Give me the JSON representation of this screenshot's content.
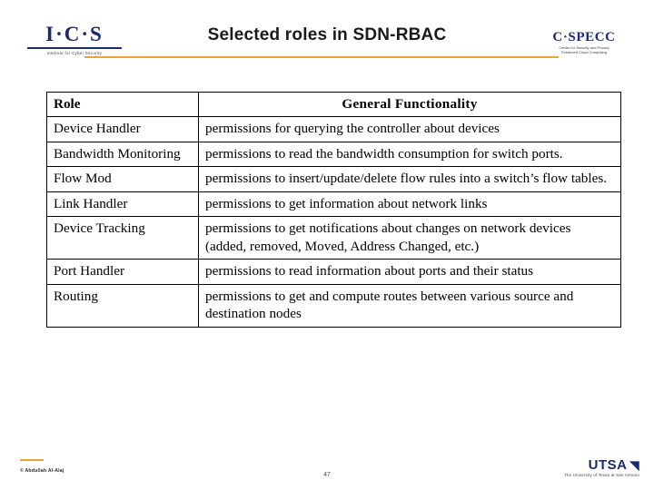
{
  "slide": {
    "title": "Selected roles in SDN-RBAC",
    "accent_color": "#e8a33d",
    "navy_color": "#1b2a6b"
  },
  "logos": {
    "left": {
      "mark": "I·C·S",
      "sub": "Institute for Cyber Security"
    },
    "right": {
      "mark": "C·SPECC",
      "sub1": "Center for Security and Privacy",
      "sub2": "Enhanced Cloud Computing"
    },
    "footer": {
      "mark": "UTSA",
      "glyph": "◥",
      "sub": "The University of Texas at San Antonio"
    }
  },
  "table": {
    "headers": [
      "Role",
      "General  Functionality"
    ],
    "rows": [
      {
        "role": "Device Handler",
        "functionality": "permissions for querying the controller about devices"
      },
      {
        "role": "Bandwidth Monitoring",
        "functionality": "permissions to read the bandwidth consumption for switch ports."
      },
      {
        "role": "Flow Mod",
        "functionality": "permissions to insert/update/delete flow rules into a switch’s flow tables."
      },
      {
        "role": "Link Handler",
        "functionality": "permissions to get information about network links"
      },
      {
        "role": "Device Tracking",
        "functionality": "permissions to get notifications about changes on network devices (added, removed, Moved, Address Changed, etc.)"
      },
      {
        "role": "Port Handler",
        "functionality": "permissions to read information about ports and their status"
      },
      {
        "role": "Routing",
        "functionality": "permissions to get and compute routes between various source and destination nodes"
      }
    ]
  },
  "footer": {
    "credit": "© Abdullah Al-Alaj",
    "page_number": "47"
  }
}
